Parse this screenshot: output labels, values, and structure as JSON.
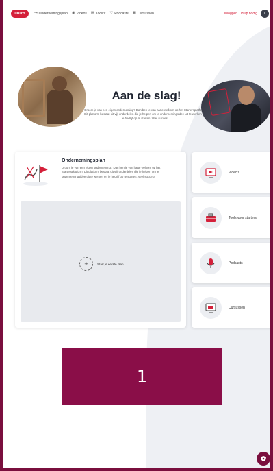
{
  "header": {
    "logo_text": "unizo",
    "nav": [
      {
        "icon": "route-icon",
        "glyph": "↝",
        "label": "Ondernemingsplan"
      },
      {
        "icon": "video-icon",
        "glyph": "◉",
        "label": "Videos"
      },
      {
        "icon": "toolkit-icon",
        "glyph": "▤",
        "label": "Toolkit"
      },
      {
        "icon": "podcast-icon",
        "glyph": "♡",
        "label": "Podcasts"
      },
      {
        "icon": "courses-icon",
        "glyph": "▦",
        "label": "Cursussen"
      }
    ],
    "links": {
      "login": "Inloggen",
      "help": "Hulp nodig"
    },
    "avatar_text": "JL"
  },
  "hero": {
    "title": "Aan de slag!",
    "text": "Droom je van een eigen onderneming? Dan ben je van harte welkom op het Startersplatform. Dit platform bestaat uit vijf onderdelen die je helpen om je ondernemingsidee uit te werken en je bedrijf op te starten. Veel succes!"
  },
  "plan_card": {
    "title": "Ondernemingsplan",
    "text": "Droom je van een eigen onderneming? Dan ben je van harte welkom op het Startersplatform. Dit platform bestaat uit vijf onderdelen die je helpen om je ondernemingsidee uit te werken en je bedrijf op te starten. Veel succes!",
    "start_label": "Start je eerste plan"
  },
  "side_cards": [
    {
      "icon": "video-icon",
      "label": "Video's"
    },
    {
      "icon": "toolbox-icon",
      "label": "Tools voor starters"
    },
    {
      "icon": "microphone-icon",
      "label": "Podcasts"
    },
    {
      "icon": "monitor-icon",
      "label": "Cursussen"
    }
  ],
  "overlay": {
    "number": "1"
  },
  "colors": {
    "brand_red": "#d4203a",
    "frame": "#7a0f3e",
    "overlay": "#8a0e48",
    "bg_shape": "#eef0f4"
  }
}
